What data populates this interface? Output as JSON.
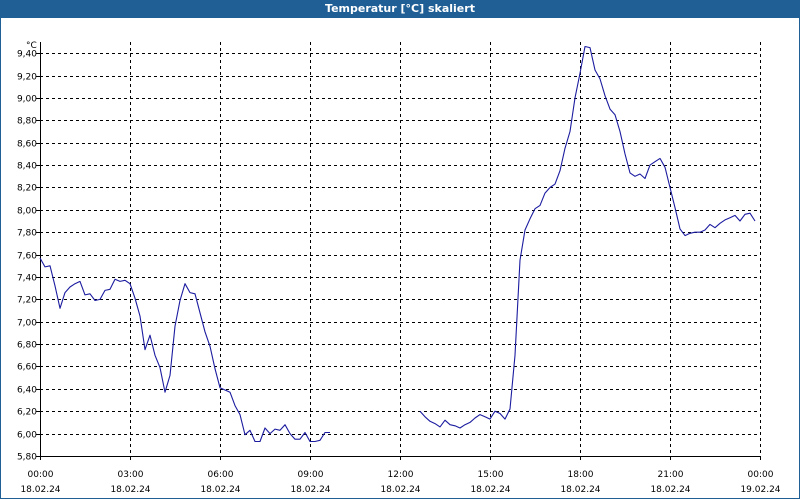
{
  "title": "Temperatur [°C] skaliert",
  "chart_data": {
    "type": "line",
    "title": "Temperatur [°C] skaliert",
    "ylabel": "°C",
    "ylim": [
      5.8,
      9.5
    ],
    "y_ticks": [
      "9,40",
      "9,20",
      "9,00",
      "8,80",
      "8,60",
      "8,40",
      "8,20",
      "8,00",
      "7,80",
      "7,60",
      "7,40",
      "7,20",
      "7,00",
      "6,80",
      "6,60",
      "6,40",
      "6,20",
      "6,00",
      "5,80"
    ],
    "x_ticks": [
      {
        "time": "00:00",
        "date": "18.02.24"
      },
      {
        "time": "03:00",
        "date": "18.02.24"
      },
      {
        "time": "06:00",
        "date": "18.02.24"
      },
      {
        "time": "09:00",
        "date": "18.02.24"
      },
      {
        "time": "12:00",
        "date": "18.02.24"
      },
      {
        "time": "15:00",
        "date": "18.02.24"
      },
      {
        "time": "18:00",
        "date": "18.02.24"
      },
      {
        "time": "21:00",
        "date": "18.02.24"
      },
      {
        "time": "00:00",
        "date": "19.02.24"
      }
    ],
    "grid": true,
    "series": [
      {
        "color": "#1c1ca0",
        "segments": [
          [
            [
              "00:00",
              7.57
            ],
            [
              "00:10",
              7.49
            ],
            [
              "00:20",
              7.5
            ],
            [
              "00:30",
              7.32
            ],
            [
              "00:40",
              7.12
            ],
            [
              "00:50",
              7.26
            ],
            [
              "01:00",
              7.31
            ],
            [
              "01:10",
              7.34
            ],
            [
              "01:20",
              7.36
            ],
            [
              "01:30",
              7.24
            ],
            [
              "01:40",
              7.25
            ],
            [
              "01:50",
              7.19
            ],
            [
              "02:00",
              7.2
            ],
            [
              "02:10",
              7.28
            ],
            [
              "02:20",
              7.29
            ],
            [
              "02:30",
              7.38
            ],
            [
              "02:40",
              7.36
            ],
            [
              "02:50",
              7.37
            ],
            [
              "03:00",
              7.34
            ],
            [
              "03:10",
              7.21
            ],
            [
              "03:20",
              7.05
            ],
            [
              "03:30",
              6.75
            ],
            [
              "03:40",
              6.88
            ],
            [
              "03:50",
              6.7
            ],
            [
              "04:00",
              6.59
            ],
            [
              "04:10",
              6.37
            ],
            [
              "04:20",
              6.52
            ],
            [
              "04:30",
              6.96
            ],
            [
              "04:40",
              7.19
            ],
            [
              "04:50",
              7.34
            ],
            [
              "05:00",
              7.26
            ],
            [
              "05:10",
              7.25
            ],
            [
              "05:20",
              7.08
            ],
            [
              "05:30",
              6.91
            ],
            [
              "05:40",
              6.78
            ],
            [
              "05:50",
              6.58
            ],
            [
              "06:00",
              6.41
            ],
            [
              "06:10",
              6.39
            ],
            [
              "06:20",
              6.37
            ],
            [
              "06:30",
              6.25
            ],
            [
              "06:40",
              6.17
            ],
            [
              "06:50",
              5.99
            ],
            [
              "07:00",
              6.03
            ],
            [
              "07:10",
              5.93
            ],
            [
              "07:20",
              5.93
            ],
            [
              "07:30",
              6.05
            ],
            [
              "07:40",
              6.0
            ],
            [
              "07:50",
              6.04
            ],
            [
              "08:00",
              6.03
            ],
            [
              "08:10",
              6.08
            ],
            [
              "08:20",
              6.0
            ],
            [
              "08:30",
              5.95
            ],
            [
              "08:40",
              5.95
            ],
            [
              "08:50",
              6.01
            ],
            [
              "09:00",
              5.93
            ],
            [
              "09:10",
              5.93
            ],
            [
              "09:20",
              5.94
            ],
            [
              "09:30",
              6.01
            ],
            [
              "09:40",
              6.01
            ]
          ],
          [
            [
              "12:40",
              6.2
            ],
            [
              "12:50",
              6.15
            ],
            [
              "13:00",
              6.11
            ],
            [
              "13:10",
              6.09
            ],
            [
              "13:20",
              6.06
            ],
            [
              "13:30",
              6.12
            ],
            [
              "13:40",
              6.08
            ],
            [
              "13:50",
              6.07
            ],
            [
              "14:00",
              6.05
            ],
            [
              "14:10",
              6.08
            ],
            [
              "14:20",
              6.1
            ],
            [
              "14:30",
              6.14
            ],
            [
              "14:40",
              6.17
            ],
            [
              "14:50",
              6.15
            ],
            [
              "15:00",
              6.13
            ],
            [
              "15:10",
              6.2
            ],
            [
              "15:20",
              6.18
            ],
            [
              "15:30",
              6.13
            ],
            [
              "15:40",
              6.22
            ],
            [
              "15:50",
              6.7
            ],
            [
              "16:00",
              7.55
            ],
            [
              "16:10",
              7.82
            ],
            [
              "16:20",
              7.92
            ],
            [
              "16:30",
              8.01
            ],
            [
              "16:40",
              8.04
            ],
            [
              "16:50",
              8.15
            ],
            [
              "17:00",
              8.2
            ],
            [
              "17:10",
              8.23
            ],
            [
              "17:20",
              8.35
            ],
            [
              "17:30",
              8.55
            ],
            [
              "17:40",
              8.7
            ],
            [
              "17:50",
              9.0
            ],
            [
              "18:00",
              9.22
            ],
            [
              "18:10",
              9.46
            ],
            [
              "18:20",
              9.45
            ],
            [
              "18:30",
              9.25
            ],
            [
              "18:40",
              9.17
            ],
            [
              "18:50",
              9.02
            ],
            [
              "19:00",
              8.9
            ],
            [
              "19:10",
              8.85
            ],
            [
              "19:20",
              8.7
            ],
            [
              "19:30",
              8.5
            ],
            [
              "19:40",
              8.33
            ],
            [
              "19:50",
              8.3
            ],
            [
              "20:00",
              8.32
            ],
            [
              "20:10",
              8.28
            ],
            [
              "20:20",
              8.4
            ],
            [
              "20:30",
              8.43
            ],
            [
              "20:40",
              8.46
            ],
            [
              "20:50",
              8.38
            ],
            [
              "21:00",
              8.2
            ],
            [
              "21:10",
              8.02
            ],
            [
              "21:20",
              7.83
            ],
            [
              "21:30",
              7.77
            ],
            [
              "21:40",
              7.79
            ],
            [
              "21:50",
              7.8
            ],
            [
              "22:00",
              7.8
            ],
            [
              "22:10",
              7.82
            ],
            [
              "22:20",
              7.87
            ],
            [
              "22:30",
              7.84
            ],
            [
              "22:40",
              7.88
            ],
            [
              "22:50",
              7.91
            ],
            [
              "23:00",
              7.93
            ],
            [
              "23:10",
              7.95
            ],
            [
              "23:20",
              7.9
            ],
            [
              "23:30",
              7.96
            ],
            [
              "23:40",
              7.97
            ],
            [
              "23:50",
              7.9
            ]
          ]
        ]
      }
    ]
  }
}
